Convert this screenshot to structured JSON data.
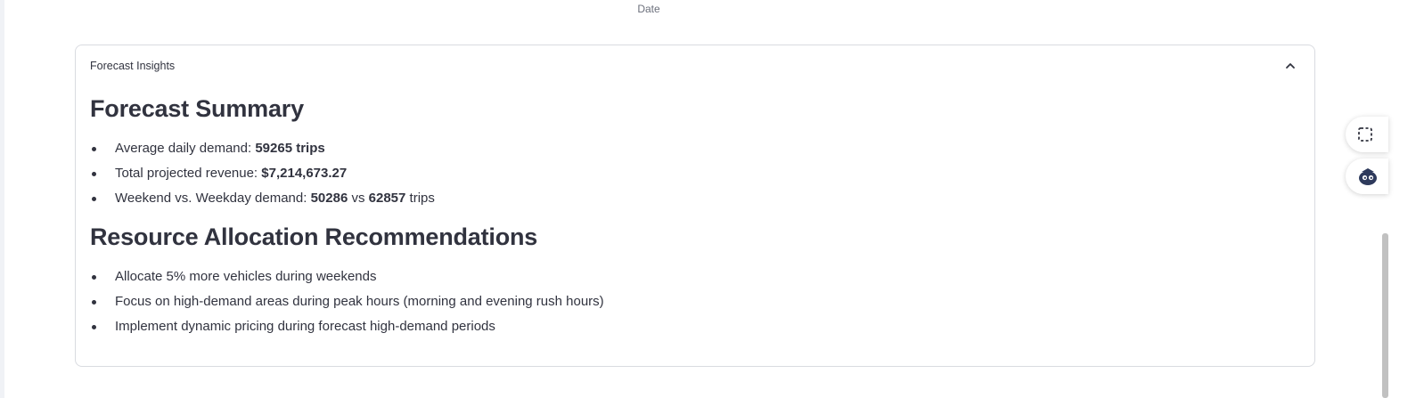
{
  "chart": {
    "x_axis_label": "Date"
  },
  "expander": {
    "title": "Forecast Insights",
    "expanded": true,
    "summary": {
      "heading": "Forecast Summary",
      "avg_demand_label": "Average daily demand: ",
      "avg_demand_value": "59265 trips",
      "revenue_label": "Total projected revenue: ",
      "revenue_value": "$7,214,673.27",
      "weekend_label": "Weekend vs. Weekday demand: ",
      "weekend_value": "50286",
      "vs_text": " vs ",
      "weekday_value": "62857",
      "trips_suffix": " trips"
    },
    "recommendations": {
      "heading": "Resource Allocation Recommendations",
      "items": [
        "Allocate 5% more vehicles during weekends",
        "Focus on high-demand areas during peak hours (morning and evening rush hours)",
        "Implement dynamic pricing during forecast high-demand periods"
      ]
    }
  },
  "icons": {
    "collapse": "chevron-up-icon",
    "screenshot": "screenshot-select-icon",
    "assistant": "assistant-mascot-icon"
  },
  "colors": {
    "text": "#31333f",
    "border": "#d9dbe0",
    "muted": "#6b6f7b"
  }
}
